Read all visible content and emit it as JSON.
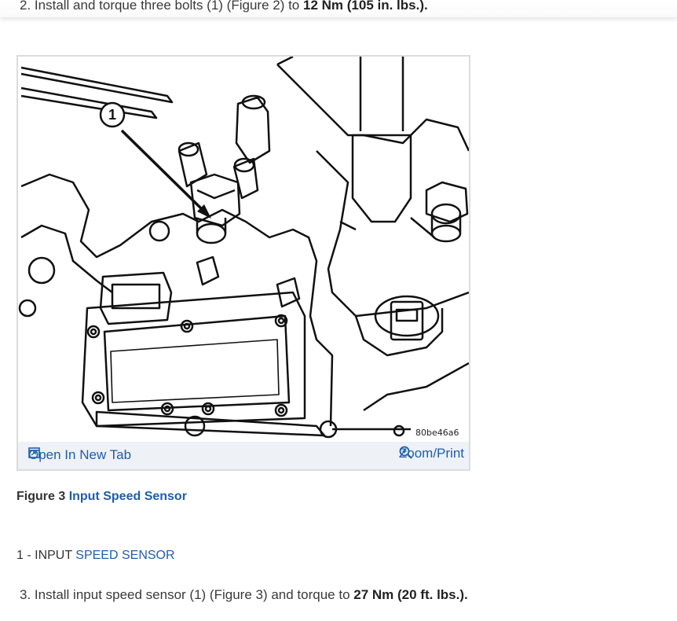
{
  "step2": {
    "number": "2.",
    "text": "Install and torque three bolts (1) (Figure 2) to",
    "torque": "12 Nm (105 in. lbs.)."
  },
  "figure": {
    "callout": "1",
    "image_code": "80be46a6",
    "open_tab_label": "Open In New Tab",
    "zoom_label": "Zoom/Print",
    "icons": {
      "open_tab": "open-new-tab-icon",
      "zoom": "zoom-in-icon"
    },
    "caption_prefix": "Figure 3",
    "caption_link": "Input Speed Sensor"
  },
  "legend": {
    "item_prefix": "1 - INPUT",
    "item_link": "SPEED SENSOR"
  },
  "step3": {
    "number": "3.",
    "text": "Install input speed sensor (1) (Figure 3) and torque to",
    "torque": "27 Nm (20 ft. lbs.)."
  },
  "colors": {
    "link": "#1f5ea8",
    "text": "#333333",
    "figure_bar": "#eef1f6"
  }
}
